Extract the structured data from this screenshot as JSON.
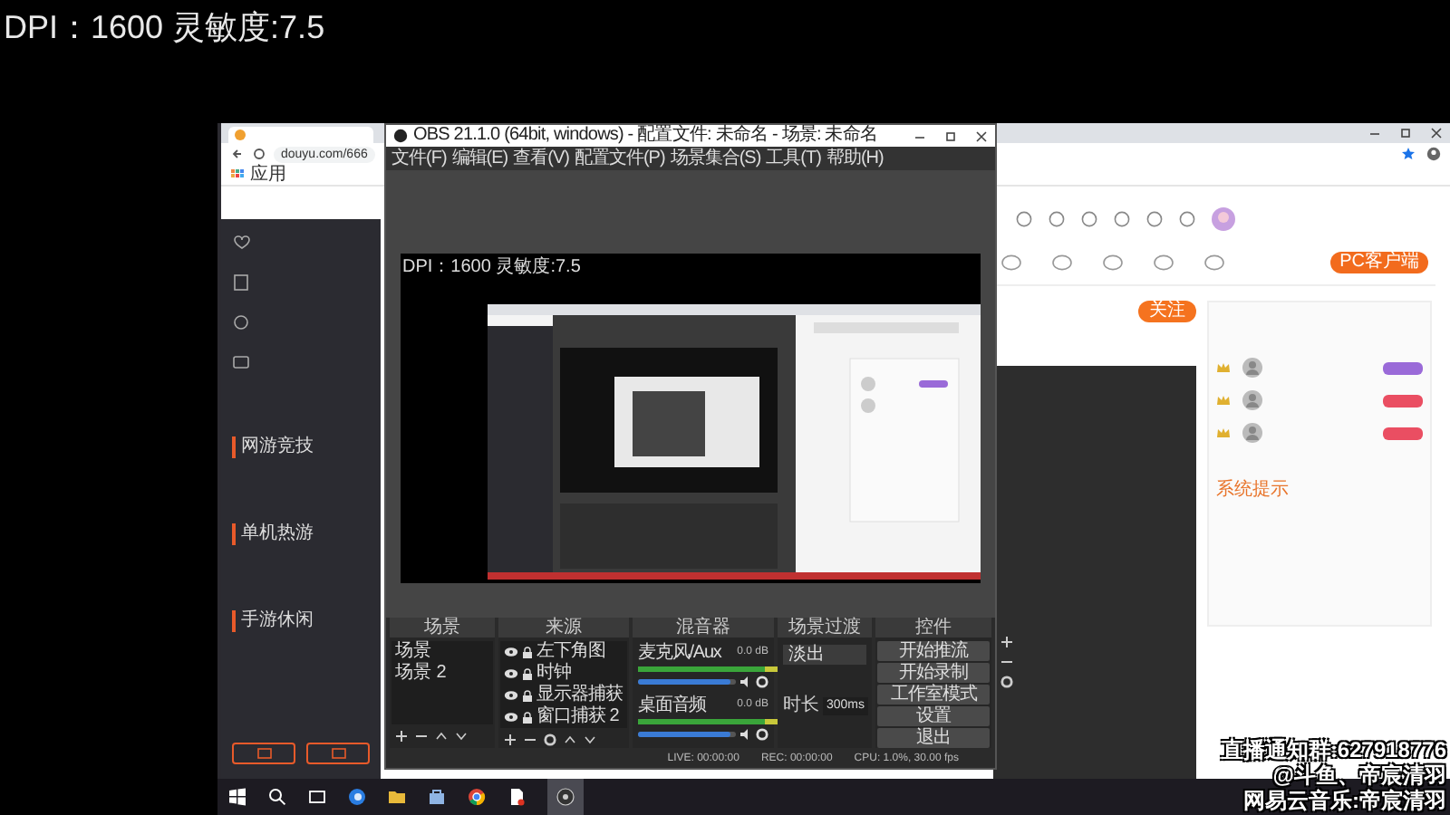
{
  "overlay": {
    "dpi_text": "DPI：1600 灵敏度:7.5"
  },
  "browser": {
    "url": "douyu.com/666",
    "bookmark": "应用",
    "sidebar_sections": [
      {
        "heading": "网游竞技"
      },
      {
        "heading": "单机热游"
      },
      {
        "heading": "手游休闲"
      }
    ],
    "pc_client_button": "PC客户端",
    "follow_button": "关注",
    "chat_notice": "系统提示"
  },
  "obs": {
    "title": "OBS 21.1.0 (64bit, windows) - 配置文件: 未命名 - 场景: 未命名",
    "menu": [
      "文件(F)",
      "编辑(E)",
      "查看(V)",
      "配置文件(P)",
      "场景集合(S)",
      "工具(T)",
      "帮助(H)"
    ],
    "preview_text": "DPI：1600 灵敏度:7.5",
    "dock_titles": [
      "场景",
      "来源",
      "混音器",
      "场景过渡",
      "控件"
    ],
    "scenes": [
      "场景",
      "场景 2"
    ],
    "sources": [
      "左下角图",
      "时钟",
      "显示器捕获",
      "窗口捕获 2"
    ],
    "mixer": [
      {
        "name": "麦克风/Aux",
        "reading": "0.0 dB",
        "level": 0.95
      },
      {
        "name": "桌面音频",
        "reading": "0.0 dB",
        "level": 0.95
      }
    ],
    "transition": {
      "name": "淡出",
      "duration_label": "时长",
      "duration": "300ms"
    },
    "controls": [
      "开始推流",
      "开始录制",
      "工作室模式",
      "设置",
      "退出"
    ],
    "status": [
      "LIVE: 00:00:00",
      "REC: 00:00:00",
      "CPU: 1.0%, 30.00 fps"
    ]
  },
  "stream_overlay": [
    "直播通知群:627918776",
    "@斗鱼、帝宸清羽",
    "网易云音乐:帝宸清羽"
  ]
}
